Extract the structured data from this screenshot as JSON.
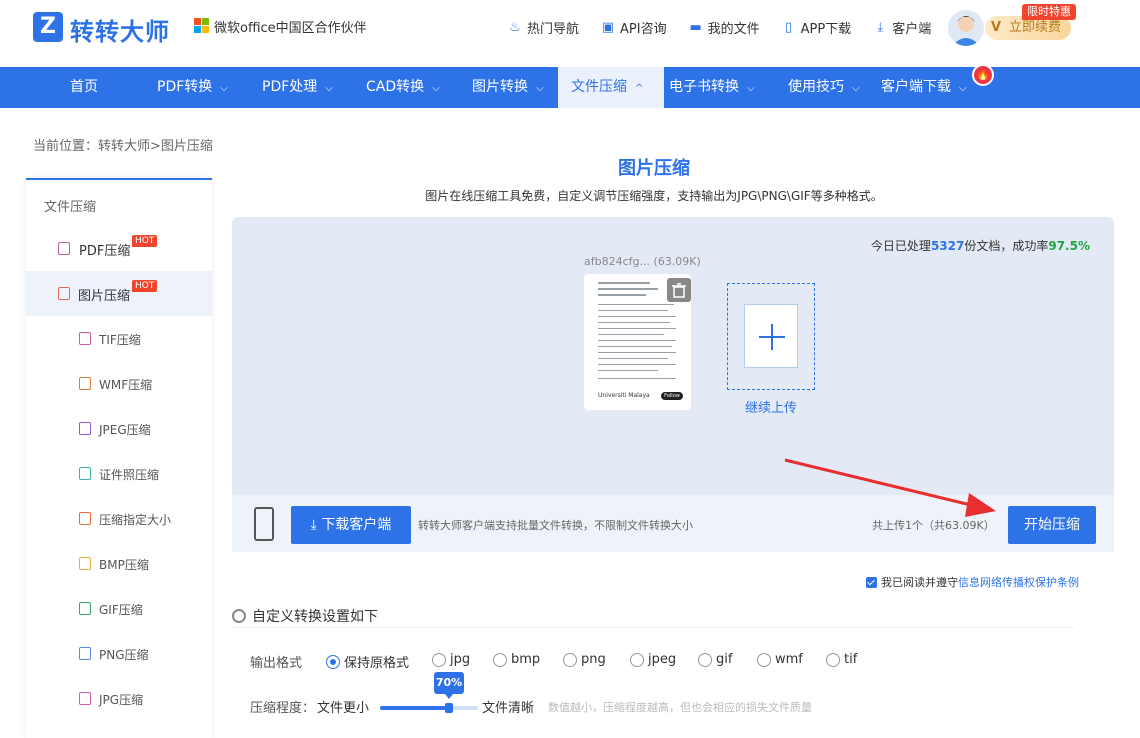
{
  "header": {
    "logo_text": "转转大师",
    "partner": "微软office中国区合作伙伴",
    "links": [
      {
        "label": "热门导航",
        "icon": "fire-icon"
      },
      {
        "label": "API咨询",
        "icon": "chat-icon"
      },
      {
        "label": "我的文件",
        "icon": "folder-icon"
      },
      {
        "label": "APP下载",
        "icon": "phone-icon"
      },
      {
        "label": "客户端",
        "icon": "download-icon"
      }
    ],
    "renew_label": "立即续费",
    "renew_badge": "V",
    "promo_badge": "限时特惠"
  },
  "nav": {
    "items": [
      {
        "label": "首页"
      },
      {
        "label": "PDF转换"
      },
      {
        "label": "PDF处理"
      },
      {
        "label": "CAD转换"
      },
      {
        "label": "图片转换"
      },
      {
        "label": "文件压缩"
      },
      {
        "label": "电子书转换"
      },
      {
        "label": "使用技巧"
      },
      {
        "label": "客户端下载"
      }
    ],
    "chevron": "⌵",
    "active_chevron": "^",
    "fire_badge": "🔥"
  },
  "breadcrumb": "当前位置：转转大师>图片压缩",
  "sidebar": {
    "heading": "文件压缩",
    "hot_badge": "HOT",
    "items": [
      {
        "label": "PDF压缩"
      },
      {
        "label": "图片压缩"
      },
      {
        "label": "TIF压缩"
      },
      {
        "label": "WMF压缩"
      },
      {
        "label": "JPEG压缩"
      },
      {
        "label": "证件照压缩"
      },
      {
        "label": "压缩指定大小"
      },
      {
        "label": "BMP压缩"
      },
      {
        "label": "GIF压缩"
      },
      {
        "label": "PNG压缩"
      },
      {
        "label": "JPG压缩"
      }
    ]
  },
  "main": {
    "title": "图片压缩",
    "subtitle": "图片在线压缩工具免费，自定义调节压缩强度，支持输出为JPG\\PNG\\GIF等多种格式。",
    "stats_prefix": "今日已处理",
    "stats_count": "5327",
    "stats_mid": "份文档，成功率",
    "stats_rate": "97.5%",
    "file_name": "afb824cfg... (63.09K)",
    "thumb_footer": "Universiti Malaya",
    "thumb_follow": "Follow",
    "add_label": "继续上传",
    "download_button": "下载客户端",
    "download_note": "转转大师客户端支持批量文件转换，不限制文件转换大小",
    "total": "共上传1个（共63.09K）",
    "start_button": "开始压缩",
    "agree_prefix": "我已阅读并遵守",
    "agree_link": "信息网络传播权保护条例"
  },
  "settings": {
    "title": "自定义转换设置如下",
    "format_label": "输出格式",
    "formats": [
      "保持原格式",
      "jpg",
      "bmp",
      "png",
      "jpeg",
      "gif",
      "wmf",
      "tif"
    ],
    "selected_format": "保持原格式",
    "compress_label": "压缩程度：",
    "compress_min": "文件更小",
    "compress_max": "文件清晰",
    "compress_value": "70%",
    "compress_level": 0.7,
    "compress_hint": "数值越小，压缩程度越高，但也会相应的损失文件质量"
  },
  "colors": {
    "primary": "#2e72e8",
    "success": "#1ca83f",
    "hot": "#f0452c"
  }
}
